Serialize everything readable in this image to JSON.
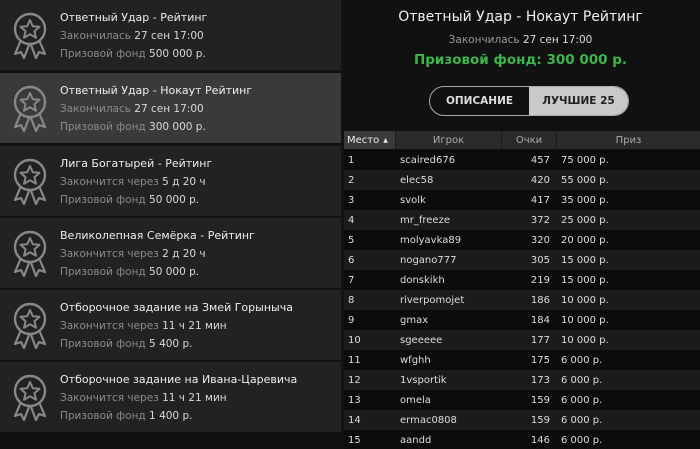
{
  "tournaments": [
    {
      "name": "Ответный Удар - Рейтинг",
      "time_label": "Закончилась",
      "time_value": "27 сен 17:00",
      "prize_label": "Призовой фонд",
      "prize_value": "500 000 р."
    },
    {
      "name": "Ответный Удар - Нокаут Рейтинг",
      "time_label": "Закончилась",
      "time_value": "27 сен 17:00",
      "prize_label": "Призовой фонд",
      "prize_value": "300 000 р."
    },
    {
      "name": "Лига Богатырей - Рейтинг",
      "time_label": "Закончится через",
      "time_value": "5 д 20 ч",
      "prize_label": "Призовой фонд",
      "prize_value": "50 000 р."
    },
    {
      "name": "Великолепная Семёрка - Рейтинг",
      "time_label": "Закончится через",
      "time_value": "2 д 20 ч",
      "prize_label": "Призовой фонд",
      "prize_value": "50 000 р."
    },
    {
      "name": "Отборочное задание на Змей Горыныча",
      "time_label": "Закончится через",
      "time_value": "11 ч 21 мин",
      "prize_label": "Призовой фонд",
      "prize_value": "5 400 р."
    },
    {
      "name": "Отборочное задание на Ивана-Царевича",
      "time_label": "Закончится через",
      "time_value": "11 ч 21 мин",
      "prize_label": "Призовой фонд",
      "prize_value": "1 400 р."
    }
  ],
  "detail": {
    "title": "Ответный Удар - Нокаут Рейтинг",
    "ended_label": "Закончилась",
    "ended_value": "27 сен 17:00",
    "prize_text": "Призовой фонд: 300 000 р.",
    "tabs": [
      "ОПИСАНИЕ",
      "ЛУЧШИЕ 25"
    ],
    "columns": [
      "Место",
      "Игрок",
      "Очки",
      "Приз"
    ],
    "sort_icon": "▲",
    "rows": [
      [
        "1",
        "scaired676",
        "457",
        "75 000 р."
      ],
      [
        "2",
        "elec58",
        "420",
        "55 000 р."
      ],
      [
        "3",
        "svolk",
        "417",
        "35 000 р."
      ],
      [
        "4",
        "mr_freeze",
        "372",
        "25 000 р."
      ],
      [
        "5",
        "molyavka89",
        "320",
        "20 000 р."
      ],
      [
        "6",
        "nogano777",
        "305",
        "15 000 р."
      ],
      [
        "7",
        "donskikh",
        "219",
        "15 000 р."
      ],
      [
        "8",
        "riverpomojet",
        "186",
        "10 000 р."
      ],
      [
        "9",
        "gmax",
        "184",
        "10 000 р."
      ],
      [
        "10",
        "sgeeeee",
        "177",
        "10 000 р."
      ],
      [
        "11",
        "wfghh",
        "175",
        "6 000 р."
      ],
      [
        "12",
        "1vsportik",
        "173",
        "6 000 р."
      ],
      [
        "13",
        "omela",
        "159",
        "6 000 р."
      ],
      [
        "14",
        "ermac0808",
        "159",
        "6 000 р."
      ],
      [
        "15",
        "aandd",
        "146",
        "6 000 р."
      ]
    ]
  },
  "colors": {
    "accent_green": "#3cb54a",
    "selected_row": "#3a3a3a"
  }
}
